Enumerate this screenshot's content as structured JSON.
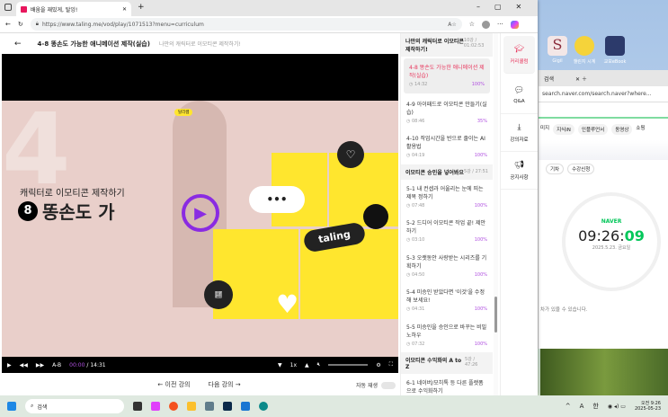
{
  "desktop": {
    "icons": [
      "Gigil",
      "챌린지 시계",
      "교보eBook"
    ]
  },
  "naver_window": {
    "tab_label": "검색",
    "url": "search.naver.com/search.naver?where...",
    "chips": [
      "미지",
      "지식iN",
      "인플루언서",
      "동영상",
      "쇼핑"
    ],
    "sub_chips": [
      "기차",
      "수강신청"
    ],
    "clock_brand": "NAVER",
    "clock_hm": "09:26:",
    "clock_s": "09",
    "clock_date": "2025.5.23. 금요일",
    "note": "차가 있을 수 있습니다."
  },
  "browser": {
    "tab_title": "배움을 재밌게, 탈잉!",
    "url": "https://www.taling.me/vod/play/1071513?menu=curriculum"
  },
  "header": {
    "title": "4-8 똥손도 가능한 애니메이션 제작(실습)",
    "subtitle": "나만의 캐릭터로 이모티콘 제작하기!"
  },
  "video": {
    "badge": "탈리쌤",
    "big_number": "4",
    "course": "캐릭터로 이모티콘 제작하기",
    "episode_num": "8",
    "episode_title": "똥손도 가",
    "brand": "taling",
    "time_current": "00:00",
    "time_sep": "/",
    "time_total": "14:31",
    "ab": "A-B",
    "speed": "1x"
  },
  "nav": {
    "prev": "← 이전 강의",
    "next": "다음 강의 →",
    "autoplay": "자동 재생"
  },
  "curriculum": {
    "top_section": {
      "title": "나만의 캐릭터로 이모티콘 제작하기!",
      "meta": "10강 / 01:02:53"
    },
    "items_a": [
      {
        "title": "4-8 똥손도 가능한 애니메이션 제작(실습)",
        "time": "14:32",
        "progress": "100%",
        "active": true
      },
      {
        "title": "4-9 아이패드로 이모티콘 만들기(실습)",
        "time": "08:46",
        "progress": "35%"
      },
      {
        "title": "4-10 작업시간을 반으로 줄이는 AI 활용법",
        "time": "04:19",
        "progress": "100%"
      }
    ],
    "section2": {
      "title": "이모티콘 승인을 넣어봐요",
      "meta": "5강 / 27:51"
    },
    "items_b": [
      {
        "title": "5-1 내 컨셉과 어울리는 눈에 띄는 제목 정하기",
        "time": "07:48",
        "progress": "100%"
      },
      {
        "title": "5-2 드디어 이모티콘 작업 끝! 제안하기",
        "time": "03:10",
        "progress": "100%"
      },
      {
        "title": "5-3 오랫동안 사랑받는 시리즈를 기획하기",
        "time": "04:50",
        "progress": "100%"
      },
      {
        "title": "5-4 미승인 받았다면 '이것'을 수정해 보세요!",
        "time": "04:31",
        "progress": "100%"
      },
      {
        "title": "5-5 미승인을 승인으로 바꾸는 비밀 노하우",
        "time": "07:32",
        "progress": "100%"
      }
    ],
    "section3": {
      "title": "이모티콘 수익화의 A to Z",
      "meta": "5강 / 47:26"
    },
    "items_c": [
      {
        "title": "6-1 네이버/모히톡 등 다른 플랫폼으로 수익화하기"
      }
    ]
  },
  "side_menu": [
    "커리큘럼",
    "Q&A",
    "강의자료",
    "공지사항"
  ],
  "taskbar": {
    "search": "검색",
    "ime1": "A",
    "ime2": "한",
    "time": "오전 9:26",
    "date": "2025-05-23"
  },
  "colors": {
    "accent": "#e8365d",
    "progress": "#b04fe0",
    "naver": "#03c75a",
    "yellow": "#ffe62e"
  }
}
